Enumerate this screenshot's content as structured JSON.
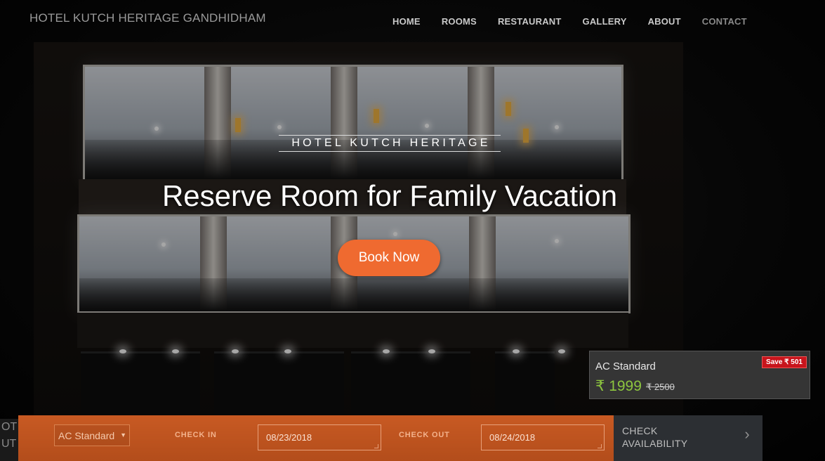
{
  "header": {
    "brand": "HOTEL KUTCH HERITAGE GANDHIDHAM",
    "nav": [
      "HOME",
      "ROOMS",
      "RESTAURANT",
      "GALLERY",
      "ABOUT",
      "CONTACT"
    ]
  },
  "hero": {
    "subtitle": "HOTEL KUTCH HERITAGE",
    "headline": "Reserve Room for Family Vacation",
    "cta": "Book Now"
  },
  "price_card": {
    "room": "AC Standard",
    "badge": "Save ₹ 501",
    "price": "₹ 1999",
    "old_price": "₹ 2500"
  },
  "booking": {
    "room_select": "AC Standard",
    "check_in_label": "CHECK IN",
    "check_in_value": "08/23/2018",
    "check_out_label": "CHECK OUT",
    "check_out_value": "08/24/2018",
    "submit_line1": "CHECK",
    "submit_line2": "AVAILABILITY",
    "arrow": "›"
  },
  "edge_text": "OT UT",
  "colors": {
    "accent": "#ef6a30",
    "booking_bar": "#c85a23",
    "price_green": "#8dc63f",
    "save_badge": "#c8141c"
  },
  "icons": [
    "dropdown-caret-icon",
    "chevron-right-icon",
    "resize-grip-icon"
  ]
}
